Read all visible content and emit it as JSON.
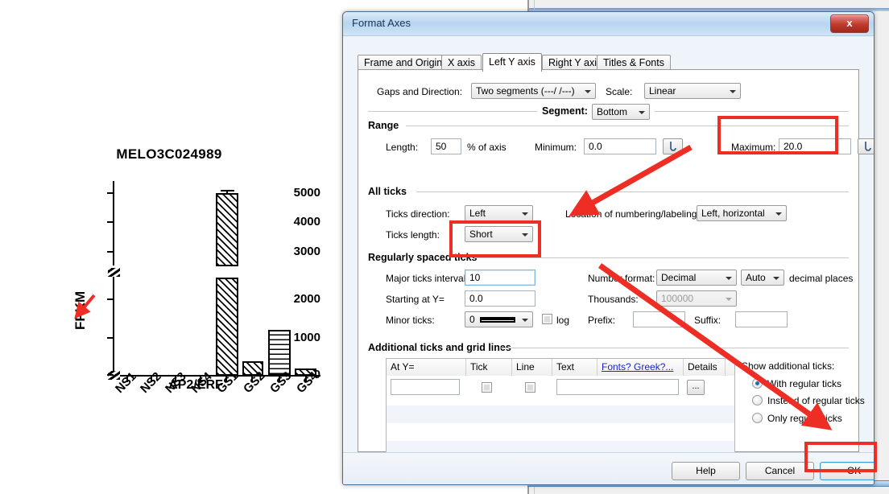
{
  "chart": {
    "title": "MELO3C024989",
    "ylabel": "FPKM",
    "xlabel": "AP2/ERF"
  },
  "chart_data": {
    "type": "bar",
    "title": "MELO3C024989",
    "xlabel": "AP2/ERF",
    "ylabel": "FPKM",
    "categories": [
      "NS1",
      "NS2",
      "NS3",
      "NS4",
      "GS1",
      "GS2",
      "GS3",
      "GS4"
    ],
    "values": [
      0,
      0,
      0,
      0,
      5150,
      380,
      1230,
      185
    ],
    "errors": [
      0,
      0,
      0,
      0,
      90,
      0,
      0,
      0
    ],
    "ytick_labels": [
      "0",
      "1000",
      "2000",
      "3000",
      "4000",
      "5000"
    ],
    "yticks": [
      0,
      1000,
      2000,
      3000,
      4000,
      5000
    ],
    "ylim": [
      0,
      5400
    ],
    "axis_break": true,
    "axis_break_range": [
      2600,
      2850
    ],
    "grid": false,
    "legend": "none",
    "bar_patterns": [
      "none",
      "none",
      "none",
      "none",
      "diagonal-hatch",
      "diagonal-hatch",
      "cross-hatch",
      "diagonal-hatch"
    ]
  },
  "dialog": {
    "title": "Format Axes",
    "close_label": "x",
    "tabs": [
      {
        "label": "Frame and Origin",
        "active": false
      },
      {
        "label": "X axis",
        "active": false
      },
      {
        "label": "Left Y axis",
        "active": true
      },
      {
        "label": "Right Y axis",
        "active": false
      },
      {
        "label": "Titles & Fonts",
        "active": false
      }
    ],
    "top": {
      "gaps_label": "Gaps and Direction:",
      "gaps_value": "Two segments (---/ /---)",
      "scale_label": "Scale:",
      "scale_value": "Linear",
      "segment_label": "Segment:",
      "segment_value": "Bottom"
    },
    "range": {
      "group": "Range",
      "length_label": "Length:",
      "length_value": "50",
      "percent_label": "% of axis",
      "minimum_label": "Minimum:",
      "minimum_value": "0.0",
      "maximum_label": "Maximum:",
      "maximum_value": "20.0"
    },
    "all_ticks": {
      "group": "All ticks",
      "direction_label": "Ticks direction:",
      "direction_value": "Left",
      "length_label": "Ticks length:",
      "length_value": "Short",
      "location_label": "Location of numbering/labeling:",
      "location_value": "Left, horizontal"
    },
    "regular_ticks": {
      "group": "Regularly spaced ticks",
      "major_label": "Major ticks interval:",
      "major_value": "10",
      "starting_label": "Starting at Y=",
      "starting_value": "0.0",
      "minor_label": "Minor ticks:",
      "minor_value": "0",
      "log_label": "log",
      "number_format_label": "Number format:",
      "number_format_value": "Decimal",
      "decimals_value": "Auto",
      "decimals_suffix": "decimal places",
      "thousands_label": "Thousands:",
      "thousands_value": "100000",
      "prefix_label": "Prefix:",
      "prefix_value": "",
      "suffix_label": "Suffix:",
      "suffix_value": ""
    },
    "additional": {
      "group": "Additional ticks and grid lines",
      "columns": [
        "At Y=",
        "Tick",
        "Line",
        "Text",
        "Fonts? Greek?...",
        "Details"
      ],
      "row_at_y": "",
      "row_text": "",
      "details_button": "...",
      "show_label": "Show additional ticks:",
      "options": [
        "With regular ticks",
        "Instead of regular ticks",
        "Only regular ticks"
      ],
      "selected_option": "With regular ticks"
    },
    "footer": {
      "help": "Help",
      "cancel": "Cancel",
      "ok": "OK"
    }
  },
  "annotations": {
    "highlight_color": "#ee2d24",
    "boxes": [
      "maximum-field",
      "major-ticks-interval-field",
      "ok-button"
    ],
    "arrows": [
      "arrow-to-regularly-spaced-ticks",
      "arrow-to-ok-button",
      "arrow-to-chart-axis"
    ]
  }
}
